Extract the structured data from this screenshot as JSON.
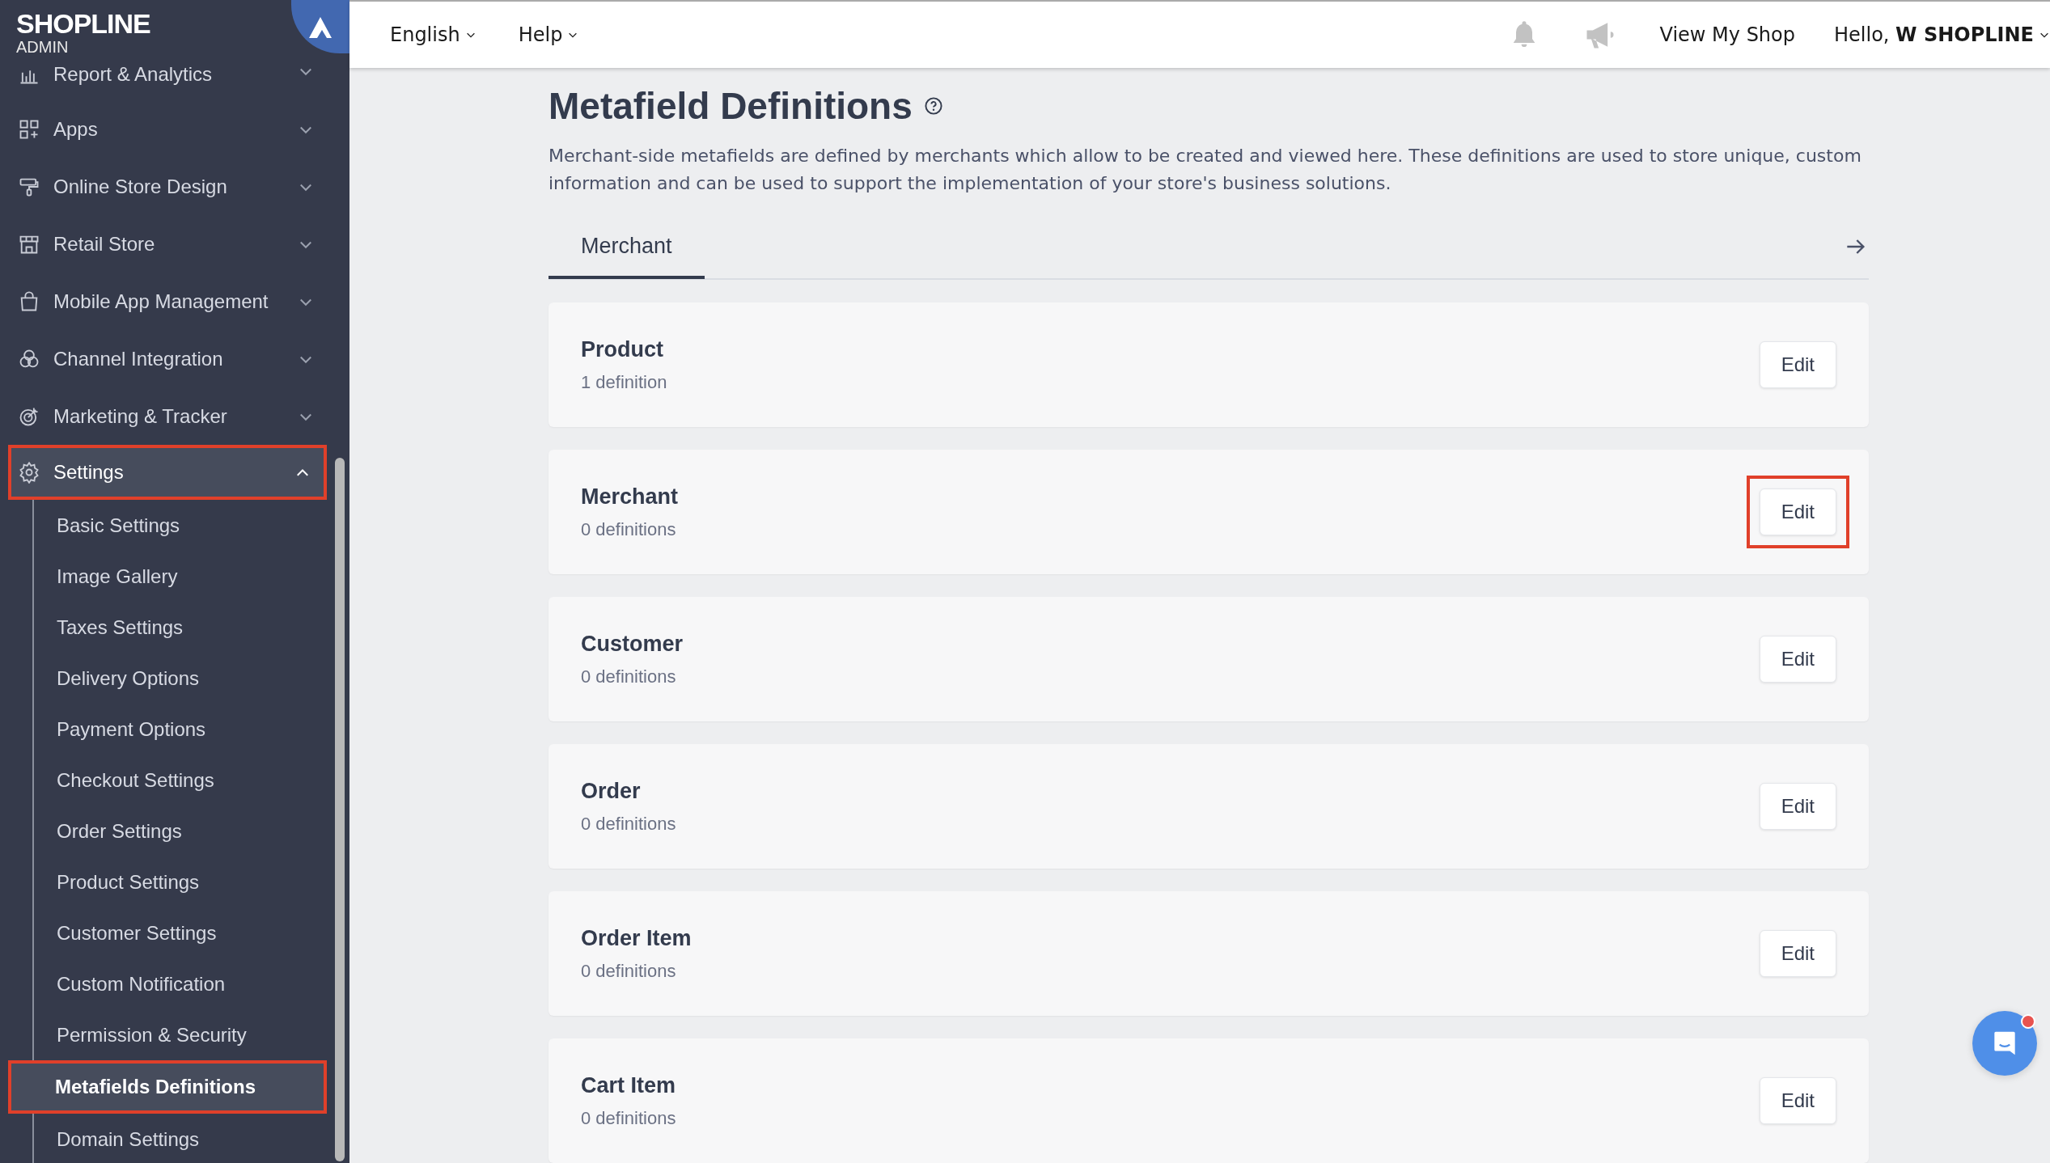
{
  "logo": {
    "brand": "SHOPLINE",
    "sub": "ADMIN"
  },
  "sidebar": {
    "items": [
      {
        "label": "Report & Analytics",
        "expanded": false,
        "selected": false,
        "highlighted": false
      },
      {
        "label": "Apps",
        "expanded": false,
        "selected": false,
        "highlighted": false
      },
      {
        "label": "Online Store Design",
        "expanded": false,
        "selected": false,
        "highlighted": false
      },
      {
        "label": "Retail Store",
        "expanded": false,
        "selected": false,
        "highlighted": false
      },
      {
        "label": "Mobile App Management",
        "expanded": false,
        "selected": false,
        "highlighted": false
      },
      {
        "label": "Channel Integration",
        "expanded": false,
        "selected": false,
        "highlighted": false
      },
      {
        "label": "Marketing & Tracker",
        "expanded": false,
        "selected": false,
        "highlighted": false
      },
      {
        "label": "Settings",
        "expanded": true,
        "selected": true,
        "highlighted": true,
        "children": [
          {
            "label": "Basic Settings",
            "selected": false,
            "highlighted": false
          },
          {
            "label": "Image Gallery",
            "selected": false,
            "highlighted": false
          },
          {
            "label": "Taxes Settings",
            "selected": false,
            "highlighted": false
          },
          {
            "label": "Delivery Options",
            "selected": false,
            "highlighted": false
          },
          {
            "label": "Payment Options",
            "selected": false,
            "highlighted": false
          },
          {
            "label": "Checkout Settings",
            "selected": false,
            "highlighted": false
          },
          {
            "label": "Order Settings",
            "selected": false,
            "highlighted": false
          },
          {
            "label": "Product Settings",
            "selected": false,
            "highlighted": false
          },
          {
            "label": "Customer Settings",
            "selected": false,
            "highlighted": false
          },
          {
            "label": "Custom Notification",
            "selected": false,
            "highlighted": false
          },
          {
            "label": "Permission & Security",
            "selected": false,
            "highlighted": false
          },
          {
            "label": "Metafields Definitions",
            "selected": true,
            "highlighted": true
          },
          {
            "label": "Domain Settings",
            "selected": false,
            "highlighted": false
          }
        ]
      }
    ]
  },
  "header": {
    "language": "English",
    "help": "Help",
    "view_shop": "View My Shop",
    "greeting": "Hello, **W SHOPLINE**"
  },
  "page": {
    "title": "Metafield Definitions",
    "description": "Merchant-side metafields are defined by merchants which allow to be created and viewed here. These definitions are used to store unique, custom information and can be used to support the implementation of your store's business solutions.",
    "tabs": [
      {
        "label": "Merchant",
        "selected": true
      }
    ],
    "cards": [
      {
        "title": "Product",
        "count": "1 definition",
        "button": "Edit",
        "highlighted": false
      },
      {
        "title": "Merchant",
        "count": "0 definitions",
        "button": "Edit",
        "highlighted": true
      },
      {
        "title": "Customer",
        "count": "0 definitions",
        "button": "Edit",
        "highlighted": false
      },
      {
        "title": "Order",
        "count": "0 definitions",
        "button": "Edit",
        "highlighted": false
      },
      {
        "title": "Order Item",
        "count": "0 definitions",
        "button": "Edit",
        "highlighted": false
      },
      {
        "title": "Cart Item",
        "count": "0 definitions",
        "button": "Edit",
        "highlighted": false
      }
    ]
  },
  "chat": {
    "unread": true
  }
}
